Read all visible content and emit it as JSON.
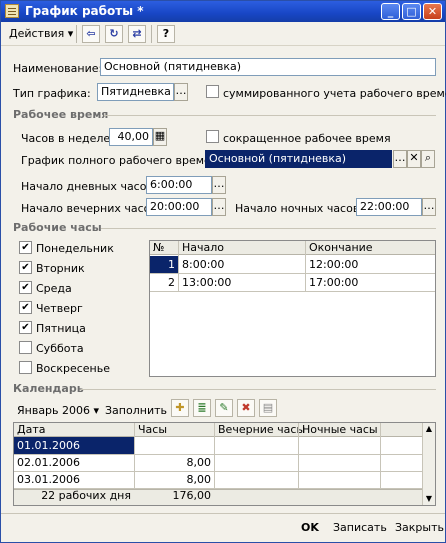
{
  "window": {
    "title": "График работы *"
  },
  "toolbar": {
    "actions_label": "Действия"
  },
  "fields": {
    "name_label": "Наименование:",
    "name_value": "Основной (пятидневка)",
    "type_label": "Тип графика:",
    "type_value": "Пятидневка",
    "summary_label": "суммированного учета рабочего времени"
  },
  "work_time": {
    "section": "Рабочее время",
    "hours_week_label": "Часов в неделе:",
    "hours_week_value": "40,00",
    "reduced_label": "сокращенное рабочее время",
    "full_schedule_label": "График полного рабочего времени:",
    "full_schedule_value": "Основной (пятидневка)",
    "day_start_label": "Начало дневных часов:",
    "day_start_value": "6:00:00",
    "evening_start_label": "Начало вечерних часов:",
    "evening_start_value": "20:00:00",
    "night_start_label": "Начало ночных часов:",
    "night_start_value": "22:00:00"
  },
  "work_hours": {
    "section": "Рабочие часы",
    "days": [
      {
        "label": "Понедельник",
        "checked": true
      },
      {
        "label": "Вторник",
        "checked": true
      },
      {
        "label": "Среда",
        "checked": true
      },
      {
        "label": "Четверг",
        "checked": true
      },
      {
        "label": "Пятница",
        "checked": true
      },
      {
        "label": "Суббота",
        "checked": false
      },
      {
        "label": "Воскресенье",
        "checked": false
      }
    ],
    "table": {
      "headers": [
        "№",
        "Начало",
        "Окончание"
      ],
      "rows": [
        [
          "1",
          "8:00:00",
          "12:00:00"
        ],
        [
          "2",
          "13:00:00",
          "17:00:00"
        ]
      ]
    }
  },
  "calendar": {
    "section": "Календарь",
    "period": "Январь 2006",
    "fill_label": "Заполнить",
    "headers": [
      "Дата",
      "Часы",
      "Вечерние часы",
      "Ночные часы"
    ],
    "rows": [
      [
        "01.01.2006",
        "",
        "",
        ""
      ],
      [
        "02.01.2006",
        "8,00",
        "",
        ""
      ],
      [
        "03.01.2006",
        "8,00",
        "",
        ""
      ]
    ],
    "footer": {
      "days": "22 рабочих дня",
      "hours": "176,00"
    }
  },
  "buttons": {
    "ok": "OK",
    "save": "Записать",
    "close": "Закрыть"
  }
}
